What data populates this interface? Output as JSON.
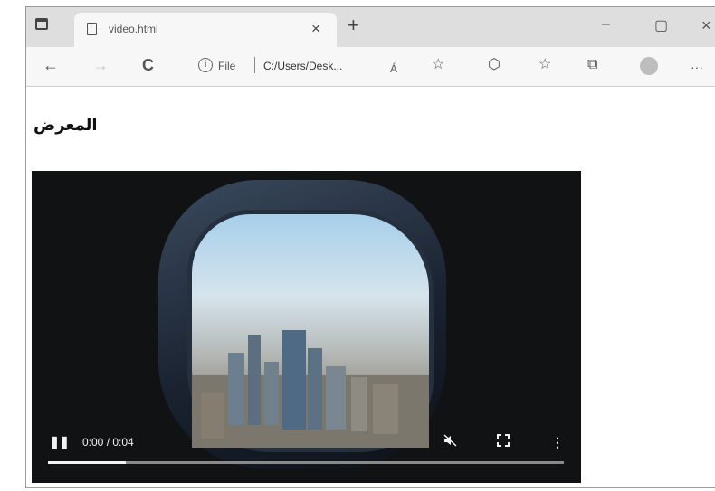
{
  "browser": {
    "tab_title": "video.html",
    "tab_close": "×",
    "new_tab": "+",
    "window_controls": {
      "minimize": "–",
      "maximize": "▢",
      "close": "×"
    },
    "toolbar": {
      "back": "←",
      "forward": "→",
      "refresh": "C",
      "address_info": "i",
      "address_label": "File",
      "address_url": "C:/Users/Desk...",
      "read_aloud": "Á",
      "favorites_add": "☆",
      "extensions": "⬡",
      "favorites": "☆",
      "collections": "⧉",
      "profile": "",
      "more": "···"
    },
    "icons": {
      "tab_actions": "tab-actions-icon",
      "page": "page-icon",
      "info": "info-icon",
      "profile": "avatar-icon"
    }
  },
  "page": {
    "heading": "المعرض",
    "video": {
      "time_display": "0:00 / 0:04",
      "progress": 0.15,
      "play_state_icon": "pause-icon",
      "muted_icon": "muted-speaker-icon",
      "fullscreen_icon": "fullscreen-icon",
      "menu_icon": "more-vertical-icon"
    }
  }
}
